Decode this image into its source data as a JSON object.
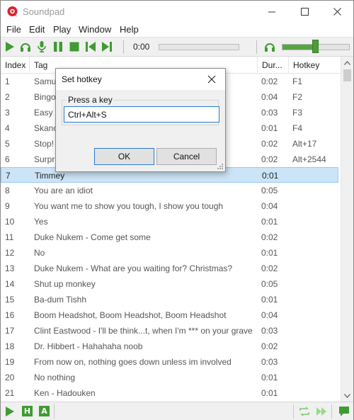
{
  "window": {
    "title": "Soundpad"
  },
  "menu": [
    "File",
    "Edit",
    "Play",
    "Window",
    "Help"
  ],
  "toolbar": {
    "time": "0:00",
    "progress": 0,
    "volume": 0.5
  },
  "columns": {
    "index": "Index",
    "tag": "Tag",
    "duration": "Dur...",
    "hotkey": "Hotkey"
  },
  "rows": [
    {
      "index": "1",
      "tag": "Samu",
      "duration": "0:02",
      "hotkey": "F1"
    },
    {
      "index": "2",
      "tag": "Bingo",
      "duration": "0:04",
      "hotkey": "F2"
    },
    {
      "index": "3",
      "tag": "Easy p",
      "duration": "0:03",
      "hotkey": "F3"
    },
    {
      "index": "4",
      "tag": "Skanc",
      "duration": "0:01",
      "hotkey": "F4"
    },
    {
      "index": "5",
      "tag": "Stop!",
      "duration": "0:02",
      "hotkey": "Alt+17"
    },
    {
      "index": "6",
      "tag": "Surpr",
      "duration": "0:02",
      "hotkey": "Alt+2544"
    },
    {
      "index": "7",
      "tag": "Timmey",
      "duration": "0:01",
      "hotkey": "",
      "selected": true
    },
    {
      "index": "8",
      "tag": "You are an idiot",
      "duration": "0:05",
      "hotkey": ""
    },
    {
      "index": "9",
      "tag": "You want me to show you tough, I show you tough",
      "duration": "0:04",
      "hotkey": ""
    },
    {
      "index": "10",
      "tag": "Yes",
      "duration": "0:01",
      "hotkey": ""
    },
    {
      "index": "11",
      "tag": "Duke Nukem - Come get some",
      "duration": "0:02",
      "hotkey": ""
    },
    {
      "index": "12",
      "tag": "No",
      "duration": "0:01",
      "hotkey": ""
    },
    {
      "index": "13",
      "tag": "Duke Nukem - What are you waiting for? Christmas?",
      "duration": "0:02",
      "hotkey": ""
    },
    {
      "index": "14",
      "tag": "Shut up monkey",
      "duration": "0:05",
      "hotkey": ""
    },
    {
      "index": "15",
      "tag": "Ba-dum Tishh",
      "duration": "0:01",
      "hotkey": ""
    },
    {
      "index": "16",
      "tag": "Boom Headshot, Boom Headshot, Boom Headshot",
      "duration": "0:04",
      "hotkey": ""
    },
    {
      "index": "17",
      "tag": "Clint Eastwood - I'll be think...t, when I'm *** on your grave",
      "duration": "0:03",
      "hotkey": ""
    },
    {
      "index": "18",
      "tag": "Dr. Hibbert - Hahahaha noob",
      "duration": "0:02",
      "hotkey": ""
    },
    {
      "index": "19",
      "tag": "From now on, nothing goes down unless im involved",
      "duration": "0:03",
      "hotkey": ""
    },
    {
      "index": "20",
      "tag": "No nothing",
      "duration": "0:01",
      "hotkey": ""
    },
    {
      "index": "21",
      "tag": "Ken - Hadouken",
      "duration": "0:01",
      "hotkey": ""
    }
  ],
  "statusbar": {
    "h_label": "H",
    "a_label": "A"
  },
  "dialog": {
    "title": "Set hotkey",
    "group_label": "Press a key",
    "input_value": "Ctrl+Alt+S",
    "ok_label": "OK",
    "cancel_label": "Cancel"
  },
  "colors": {
    "accent_green": "#3f9b32",
    "selection": "#cce4f7",
    "focus_blue": "#2b7bd0"
  }
}
